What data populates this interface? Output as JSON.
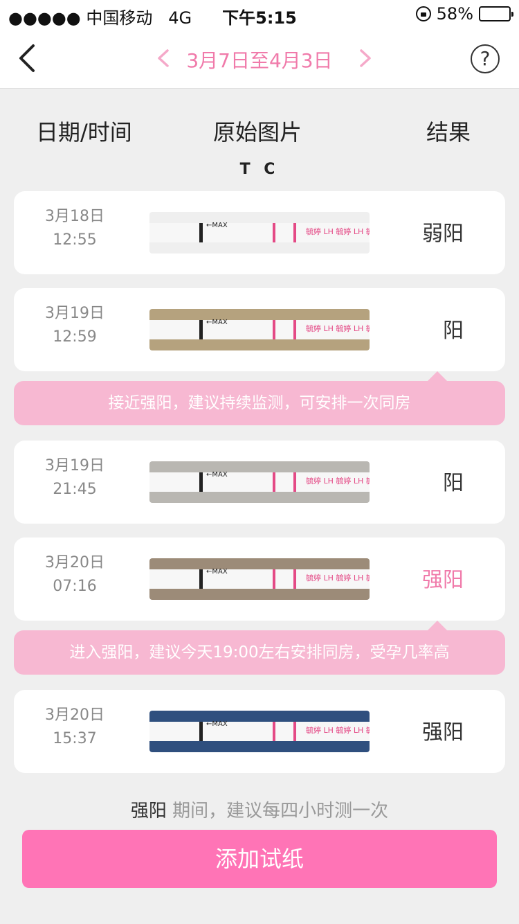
{
  "status_bar": {
    "carrier": "●●●●● 中国移动",
    "network": "4G",
    "time": "下午5:15",
    "battery": "58%",
    "battery_level": 0.58
  },
  "nav": {
    "date_range": "3月7日至4月3日",
    "help": "?"
  },
  "columns": {
    "date": "日期/时间",
    "image": "原始图片",
    "result": "结果",
    "tc": "T C"
  },
  "records": [
    {
      "date": "3月18日",
      "time": "12:55",
      "result": "弱阳",
      "result_highlight": false,
      "background": "gray"
    },
    {
      "date": "3月19日",
      "time": "12:59",
      "result": "阳",
      "result_highlight": false,
      "background": "beige"
    },
    {
      "date": "3月19日",
      "time": "21:45",
      "result": "阳",
      "result_highlight": false,
      "background": "gray"
    },
    {
      "date": "3月20日",
      "time": "07:16",
      "result": "强阳",
      "result_highlight": true,
      "background": "fur"
    },
    {
      "date": "3月20日",
      "time": "15:37",
      "result": "强阳",
      "result_highlight": false,
      "background": "denim"
    }
  ],
  "tips": [
    "接近强阳，建议持续监测，可安排一次同房",
    "进入强阳，建议今天19:00左右安排同房，受孕几率高"
  ],
  "strip_labels": {
    "max": "←MAX",
    "brand": "毓婷 LH 毓婷 LH 毓婷"
  },
  "advice": {
    "highlight": "强阳",
    "text": " 期间，建议每四小时测一次"
  },
  "add_button": "添加试纸",
  "colors": {
    "accent": "#ff74b6",
    "date_pink": "#f07aaa",
    "tip_bg": "#f7b8d2"
  }
}
